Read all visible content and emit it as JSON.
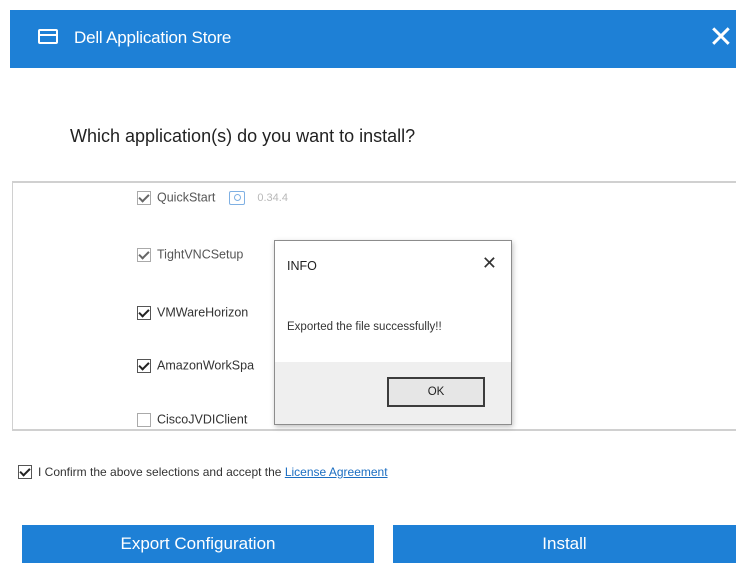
{
  "window": {
    "title": "Dell Application Store",
    "close_glyph": "✕"
  },
  "question": "Which application(s) do you want to install?",
  "apps": [
    {
      "label": "QuickStart",
      "checked": true,
      "version": "0.34.4"
    },
    {
      "label": "TightVNCSetup",
      "checked": true
    },
    {
      "label": "VMWareHorizon",
      "checked": true
    },
    {
      "label": "AmazonWorkSpa",
      "checked": true
    },
    {
      "label": "CiscoJVDIClient",
      "checked": false
    }
  ],
  "dialog": {
    "title": "INFO",
    "close_glyph": "✕",
    "message": "Exported the file successfully!!",
    "ok_label": "OK"
  },
  "confirm": {
    "text": "I Confirm the above selections and accept the ",
    "link": "License Agreement",
    "checked": true
  },
  "buttons": {
    "export": "Export Configuration",
    "install": "Install"
  },
  "colors": {
    "accent": "#1e80d6",
    "link": "#1b6ec2"
  }
}
